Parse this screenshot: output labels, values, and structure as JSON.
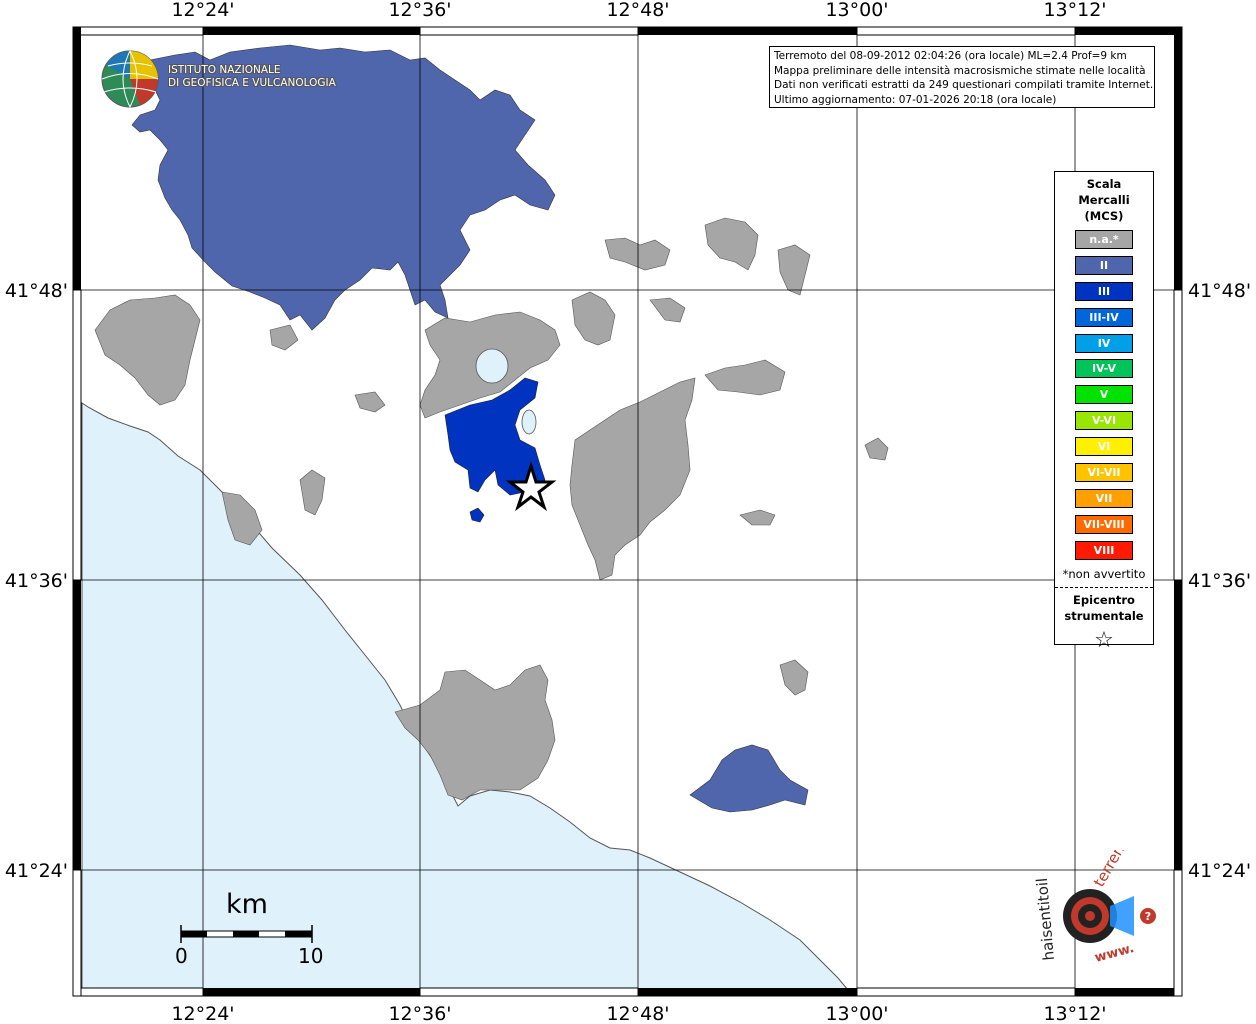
{
  "info_box": {
    "lines": [
      "Terremoto del 08-09-2012 02:04:26 (ora locale) ML=2.4 Prof=9 km",
      "Mappa preliminare delle intensità macrosismiche stimate nelle località",
      "Dati non verificati estratti da 249 questionari compilati tramite Internet.",
      "Ultimo aggiornamento: 07-01-2026 20:18 (ora locale)"
    ]
  },
  "axes": {
    "longitude_labels": [
      "12°24'",
      "12°36'",
      "12°48'",
      "13°00'",
      "13°12'"
    ],
    "latitude_labels": [
      "41°48'",
      "41°36'",
      "41°24'"
    ]
  },
  "legend": {
    "title_lines": [
      "Scala",
      "Mercalli",
      "(MCS)"
    ],
    "items": [
      {
        "label": "n.a.*",
        "color": "#a6a6a6"
      },
      {
        "label": "II",
        "color": "#4f66ad"
      },
      {
        "label": "III",
        "color": "#0033bf"
      },
      {
        "label": "III-IV",
        "color": "#0066d9"
      },
      {
        "label": "IV",
        "color": "#00a0e9"
      },
      {
        "label": "IV-V",
        "color": "#00c45a"
      },
      {
        "label": "V",
        "color": "#00e300"
      },
      {
        "label": "V-VI",
        "color": "#99e600"
      },
      {
        "label": "VI",
        "color": "#ffef00"
      },
      {
        "label": "VI-VII",
        "color": "#ffc300"
      },
      {
        "label": "VII",
        "color": "#ff9f00"
      },
      {
        "label": "VII-VIII",
        "color": "#ff6b00"
      },
      {
        "label": "VIII",
        "color": "#ff1a00"
      }
    ],
    "note": "*non avvertito",
    "epicenter_lines": [
      "Epicentro",
      "strumentale"
    ],
    "epicenter_icon": "star-outline-icon"
  },
  "scale_bar": {
    "unit": "km",
    "min_label": "0",
    "max_label": "10"
  },
  "ingv_logo": {
    "lines": [
      "ISTITUTO NAZIONALE",
      "DI GEOFISICA E VULCANOLOGIA"
    ]
  },
  "hst_logo": {
    "text": "haisentitoilterremoto.it",
    "text_top": "terremoto.it",
    "text_side": "haisentitoil",
    "text_www": "www."
  },
  "colors": {
    "sea": "#dff1fb",
    "na": "#a6a6a6",
    "intensity_II": "#4f66ad",
    "intensity_III": "#0033bf",
    "lake": "#dff1fb"
  }
}
